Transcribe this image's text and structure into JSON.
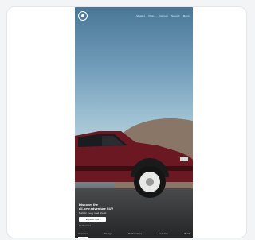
{
  "hero": {
    "top_nav": [
      "Models",
      "Offers",
      "Owners",
      "Search",
      "Menu"
    ],
    "headline_line1": "Discover the",
    "headline_line2": "all-new adventure SUV",
    "subline": "Built for every road ahead",
    "cta_label": "Explore now",
    "secondary_link": "Learn more",
    "bottom_nav": [
      "Overview",
      "Design",
      "Performance",
      "Features",
      "Build"
    ]
  },
  "colors": {
    "car_body": "#6b1822",
    "sky_top": "#4b7796",
    "dune": "#8a7666"
  }
}
